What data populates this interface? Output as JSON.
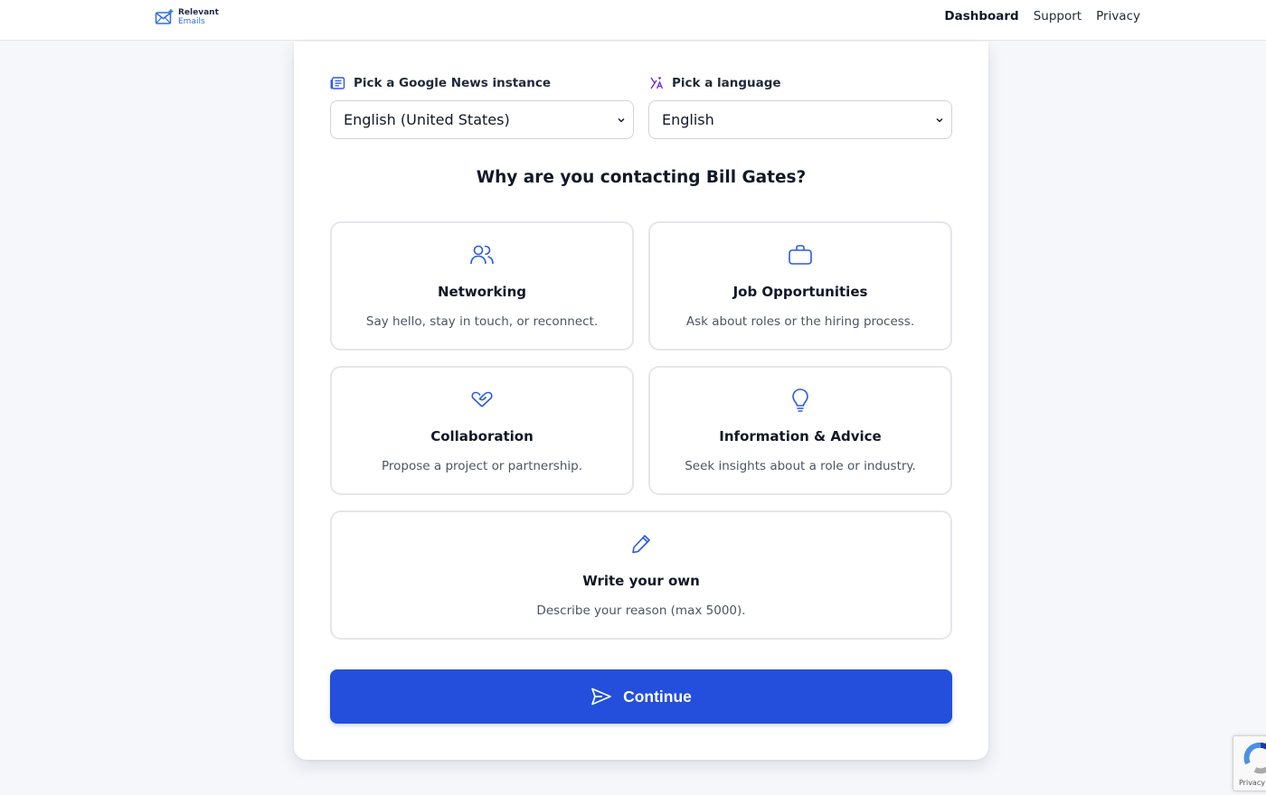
{
  "header": {
    "logo": {
      "line1": "Relevant",
      "line2": "Emails",
      "icon": "envelope-plus-icon"
    },
    "nav": [
      {
        "label": "Dashboard",
        "active": true
      },
      {
        "label": "Support",
        "active": false
      },
      {
        "label": "Privacy",
        "active": false
      }
    ]
  },
  "pickers": {
    "news": {
      "label": "Pick a Google News instance",
      "value": "English (United States)",
      "icon": "newspaper-icon"
    },
    "language": {
      "label": "Pick a language",
      "value": "English",
      "icon": "translate-icon"
    }
  },
  "question": "Why are you contacting Bill Gates?",
  "options": [
    {
      "title": "Networking",
      "description": "Say hello, stay in touch, or reconnect.",
      "icon": "users-icon"
    },
    {
      "title": "Job Opportunities",
      "description": "Ask about roles or the hiring process.",
      "icon": "briefcase-icon"
    },
    {
      "title": "Collaboration",
      "description": "Propose a project or partnership.",
      "icon": "heart-handshake-icon"
    },
    {
      "title": "Information & Advice",
      "description": "Seek insights about a role or industry.",
      "icon": "lightbulb-icon"
    },
    {
      "title": "Write your own",
      "description": "Describe your reason (max 5000).",
      "icon": "pencil-icon"
    }
  ],
  "continue_button": {
    "label": "Continue",
    "icon": "send-icon"
  },
  "recaptcha": {
    "text": "Privacy"
  },
  "colors": {
    "accent": "#234fdc",
    "icon_blue": "#2b5bdc",
    "language_icon_purple": "#6d28d9",
    "background": "#f5f7fb",
    "card_border": "#e4e6ea"
  }
}
